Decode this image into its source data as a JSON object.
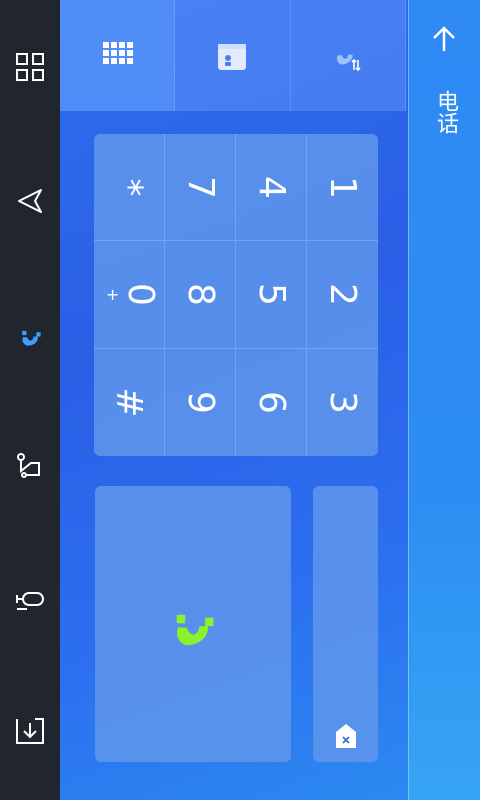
{
  "header": {
    "title": "电话"
  },
  "tabs": [
    {
      "name": "dialpad",
      "icon": "dialpad-grid-icon",
      "active": true
    },
    {
      "name": "contacts",
      "icon": "contacts-card-icon",
      "active": false
    },
    {
      "name": "call-log",
      "icon": "call-log-icon",
      "active": false
    }
  ],
  "sidebar": {
    "items": [
      {
        "name": "apps",
        "icon": "apps-grid-icon"
      },
      {
        "name": "navigation",
        "icon": "navigation-arrow-icon"
      },
      {
        "name": "phone",
        "icon": "phone-icon",
        "active": true
      },
      {
        "name": "route",
        "icon": "route-icon"
      },
      {
        "name": "voice",
        "icon": "microphone-icon"
      },
      {
        "name": "download",
        "icon": "download-icon"
      }
    ]
  },
  "keypad": {
    "keys": [
      "*",
      "7",
      "4",
      "1",
      "0",
      "8",
      "5",
      "2",
      "#",
      "9",
      "6",
      "3"
    ],
    "zero_sub": "+"
  },
  "colors": {
    "accent_phone": "#3aa0ff",
    "call_green": "#8cf02a"
  }
}
